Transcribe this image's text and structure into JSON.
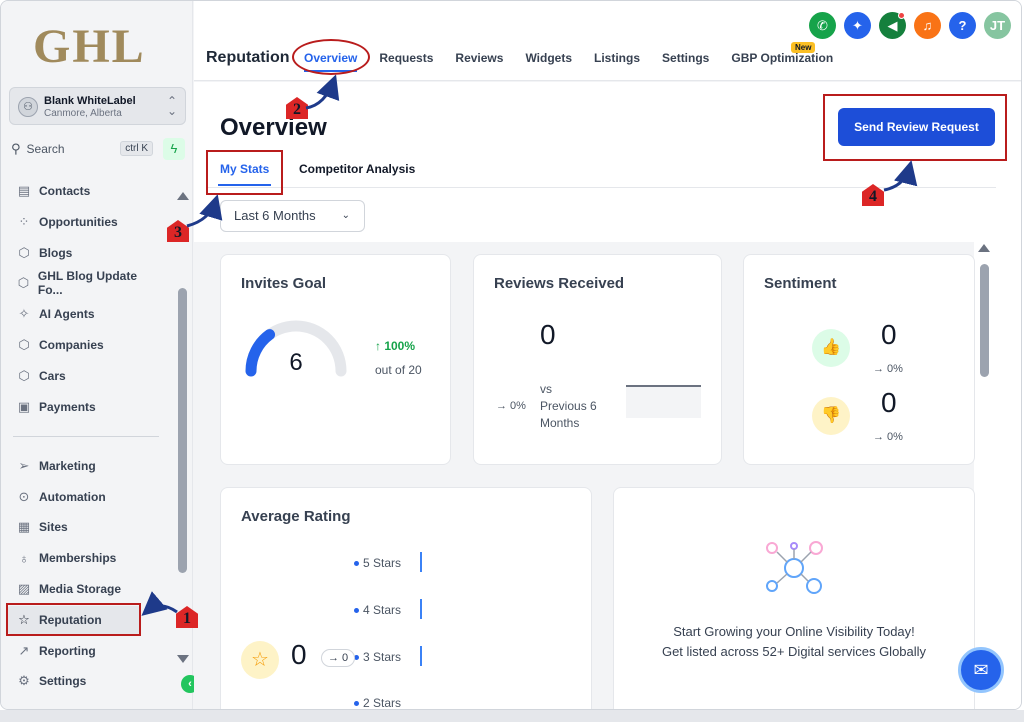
{
  "logo": "GHL",
  "account": {
    "name": "Blank WhiteLabel",
    "location": "Canmore, Alberta"
  },
  "search": {
    "label": "Search",
    "shortcut": "ctrl K"
  },
  "sidebar": {
    "items": [
      {
        "label": "Contacts"
      },
      {
        "label": "Opportunities"
      },
      {
        "label": "Blogs"
      },
      {
        "label": "GHL Blog Update Fo..."
      },
      {
        "label": "AI Agents"
      },
      {
        "label": "Companies"
      },
      {
        "label": "Cars"
      },
      {
        "label": "Payments"
      }
    ],
    "items2": [
      {
        "label": "Marketing"
      },
      {
        "label": "Automation"
      },
      {
        "label": "Sites"
      },
      {
        "label": "Memberships"
      },
      {
        "label": "Media Storage"
      },
      {
        "label": "Reputation"
      },
      {
        "label": "Reporting"
      },
      {
        "label": "Settings"
      }
    ]
  },
  "header": {
    "module": "Reputation",
    "tabs": [
      {
        "label": "Overview"
      },
      {
        "label": "Requests"
      },
      {
        "label": "Reviews"
      },
      {
        "label": "Widgets"
      },
      {
        "label": "Listings"
      },
      {
        "label": "Settings"
      },
      {
        "label": "GBP Optimization"
      }
    ],
    "new_badge": "New",
    "user_initials": "JT",
    "help": "?"
  },
  "page": {
    "title": "Overview",
    "send_button": "Send Review Request",
    "subtabs": [
      {
        "label": "My Stats"
      },
      {
        "label": "Competitor Analysis"
      }
    ],
    "date_range": "Last 6 Months"
  },
  "cards": {
    "invites": {
      "title": "Invites Goal",
      "value": "6",
      "pct": "↑ 100%",
      "out_of": "out of 20",
      "progress": 0.3
    },
    "reviews": {
      "title": "Reviews Received",
      "value": "0",
      "pct": "→ 0%",
      "vs1": "vs",
      "vs2": "Previous 6",
      "vs3": "Months"
    },
    "sentiment": {
      "title": "Sentiment",
      "pos_value": "0",
      "pos_pct": "→ 0%",
      "neg_value": "0",
      "neg_pct": "→ 0%"
    },
    "rating": {
      "title": "Average Rating",
      "value": "0",
      "chip": "→ 0",
      "rows": [
        {
          "label": "5 Stars"
        },
        {
          "label": "4 Stars"
        },
        {
          "label": "3 Stars"
        },
        {
          "label": "2 Stars"
        }
      ]
    },
    "promo": {
      "line1": "Start Growing your Online Visibility Today!",
      "line2": "Get listed across 52+ Digital services Globally"
    }
  },
  "annotations": [
    "1",
    "2",
    "3",
    "4"
  ],
  "colors": {
    "accent": "#2563eb",
    "annotation": "#b91c1c",
    "success": "#16a34a"
  }
}
